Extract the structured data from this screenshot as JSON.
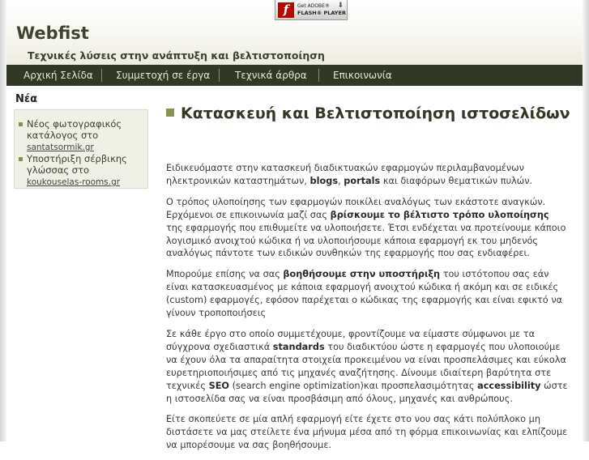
{
  "flash_badge": {
    "line1": "Get ADOBE®",
    "line2": "FLASH® PLAYER"
  },
  "header": {
    "site_title": "Webfist",
    "tagline": "Τεχνικές λύσεις στην ανάπτυξη και βελτιστοποίηση"
  },
  "nav": {
    "items": [
      {
        "label": "Αρχική Σελίδα"
      },
      {
        "label": "Συμμετοχή σε έργα"
      },
      {
        "label": "Τεχνικά άρθρα"
      },
      {
        "label": "Επικοινωνία"
      }
    ]
  },
  "sidebar": {
    "title": "Νέα",
    "news": [
      {
        "text": "Νέος φωτογραφικός κατάλογος στο",
        "link": "santatsormik.gr"
      },
      {
        "text": "Υποστήριξη σέρβικης γλώσσας στο",
        "link": "koukouselas-rooms.gr"
      }
    ]
  },
  "main": {
    "title": "Κατασκευή και Βελτιστοποίηση ιστοσελίδων",
    "p1": {
      "a": "Ειδικευόμαστε στην κατασκευή διαδικτυακών εφαρμογών περιλαμβανομένων ηλεκτρονικών καταστημάτων, ",
      "b": "blogs",
      "c": ", ",
      "d": "portals",
      "e": " και διαφόρων θεματικών πυλών."
    },
    "p2": {
      "a": "Ο τρόπος υλοποίησης των εφαρμογών ποικίλει αναλόγως των εκάστοτε αναγκών. Ερχόμενοι σε επικοινωνία μαζί σας ",
      "b": "βρίσκουμε το βέλτιστο τρόπο υλοποίησης",
      "c": " της εφαρμογής που επιθυμείτε να υλοποιήσετε. Έτσι ενδέχεται να προτείνουμε κάποιο λογισμικό ανοιχτού κώδικα ή να υλοποιήσουμε κάποια εφαρμογή εκ του μηδενός αναλόγως πάντοτε των ειδικών συνθηκών της εφαρμογής που σας ενδιαφέρει."
    },
    "p3": {
      "a": "Μπορούμε επίσης να σας ",
      "b": "βοηθήσουμε στην υποστήριξη",
      "c": " του ιστότοπου σας εάν είναι κατασκευασμένος με κάποια εφαρμογή ανοιχτού κώδικα ή ακόμη και σε ειδικές (custom) εφαρμογές, εφόσον παρέχεται ο κώδικας της εφαρμογής και είναι εφικτό να γίνουν τροποποιήσεις"
    },
    "p4": {
      "a": "Σε κάθε έργο στο οποίο συμμετέχουμε, φροντίζουμε να είμαστε σύμφωνοι με τα σύγχρονα σχεδιαστικά ",
      "b": "standards",
      "c": " του διαδικτύου ώστε η εφαρμογές που υλοποιούμε να έχουν όλα τα απαραίτητα στοιχεία προκειμένου να είναι προσπελάσιμες και εύκολα ευρετηριοποιήσιμες από τις μηχανές αναζήτησης. Δίνουμε ιδιαίτερη βαρύτητα στε τεχνικές ",
      "d": "SEO",
      "e": " (search engine optimization)και προσπελασιμότητας ",
      "f": "accessibility",
      "g": " ώστε η ιστοσελίδα σας να είναι προσβάσιμη από όλους, μηχανές και ανθρώπους."
    },
    "p5": {
      "a": "Είτε σκοπεύετε σε μία απλή εφαρμογή είτε έχετε στο νου σας κάτι πολύπλοκο μη διστάσετε να μας στείλετε ένα μήνυμα μέσα από τη φόρμα επικοινωνίας και ελπίζουμε να μπορέσουμε να σας βοηθήσουμε."
    }
  },
  "colors": {
    "nav_bg": "#313826",
    "title_color": "#333826",
    "bullet_accent": "#8b8f52",
    "news_box_bg": "#eff0e6"
  }
}
